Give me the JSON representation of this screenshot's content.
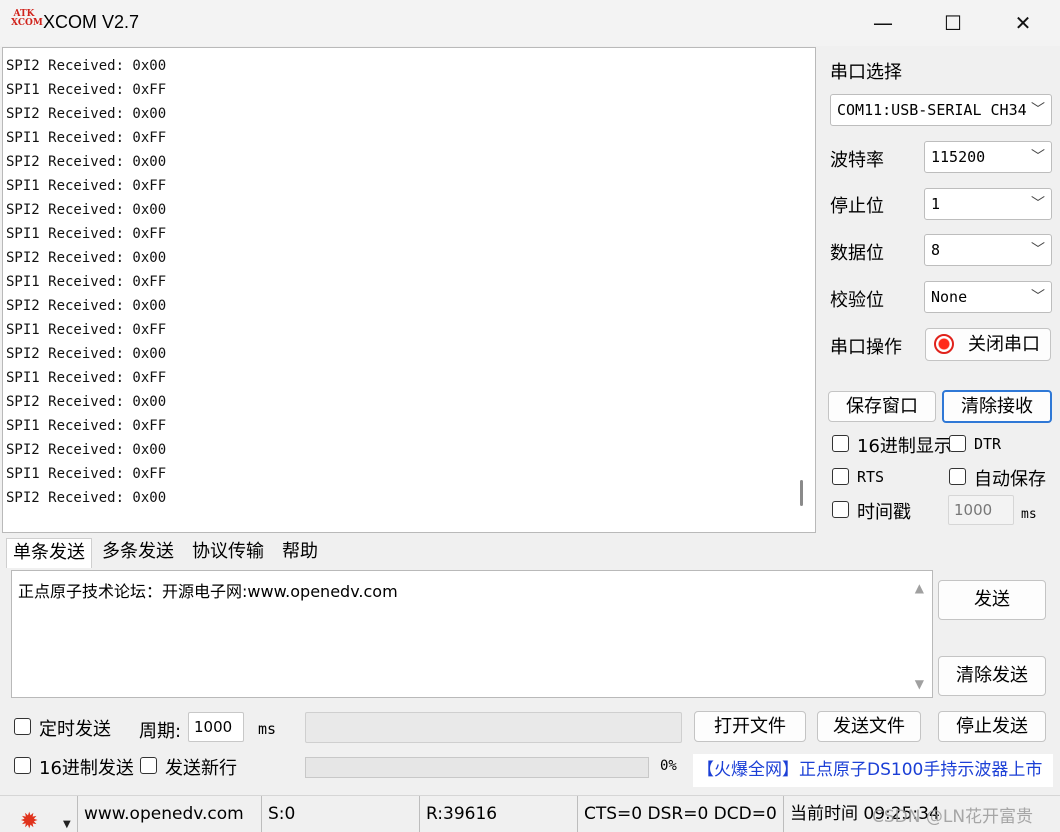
{
  "window": {
    "logo_top": "ATK",
    "logo_bottom": "XCOM",
    "title": "XCOM V2.7",
    "minimize": "—",
    "maximize": "☐",
    "close": "✕"
  },
  "receive": {
    "lines": [
      "SPI2 Received: 0x00",
      "SPI1 Received: 0xFF",
      "SPI2 Received: 0x00",
      "SPI1 Received: 0xFF",
      "SPI2 Received: 0x00",
      "SPI1 Received: 0xFF",
      "SPI2 Received: 0x00",
      "SPI1 Received: 0xFF",
      "SPI2 Received: 0x00",
      "SPI1 Received: 0xFF",
      "SPI2 Received: 0x00",
      "SPI1 Received: 0xFF",
      "SPI2 Received: 0x00",
      "SPI1 Received: 0xFF",
      "SPI2 Received: 0x00",
      "SPI1 Received: 0xFF",
      "SPI2 Received: 0x00",
      "SPI1 Received: 0xFF",
      "SPI2 Received: 0x00"
    ]
  },
  "settings": {
    "port_select_label": "串口选择",
    "port_value": "COM11:USB-SERIAL CH34",
    "baud_label": "波特率",
    "baud_value": "115200",
    "stopbits_label": "停止位",
    "stopbits_value": "1",
    "databits_label": "数据位",
    "databits_value": "8",
    "parity_label": "校验位",
    "parity_value": "None",
    "port_op_label": "串口操作",
    "close_port_button": "关闭串口",
    "save_window_button": "保存窗口",
    "clear_receive_button": "清除接收",
    "hex_display_label": "16进制显示",
    "dtr_label": "DTR",
    "rts_label": "RTS",
    "auto_save_label": "自动保存",
    "timestamp_label": "时间戳",
    "timestamp_value": "1000",
    "timestamp_unit": "ms"
  },
  "tabs": [
    "单条发送",
    "多条发送",
    "协议传输",
    "帮助"
  ],
  "send": {
    "text": "正点原子技术论坛：开源电子网:www.openedv.com",
    "send_button": "发送",
    "clear_send_button": "清除发送",
    "timed_send_label": "定时发送",
    "period_label": "周期:",
    "period_value": "1000",
    "period_unit": "ms",
    "open_file_button": "打开文件",
    "send_file_button": "发送文件",
    "stop_send_button": "停止发送",
    "hex_send_label": "16进制发送",
    "newline_label": "发送新行",
    "progress_percent": "0%",
    "progress_value": 0,
    "ad_text": "【火爆全网】正点原子DS100手持示波器上市"
  },
  "statusbar": {
    "website": "www.openedv.com",
    "sent": "S:0",
    "received": "R:39616",
    "line_status": "CTS=0 DSR=0 DCD=0",
    "time_label": "当前时间 09:25:34",
    "watermark": "CSDN @LN花开富贵"
  },
  "colors": {
    "accent": "#2f78d6",
    "logo_red": "#d0221b",
    "ad_blue": "#1b3fd6"
  }
}
